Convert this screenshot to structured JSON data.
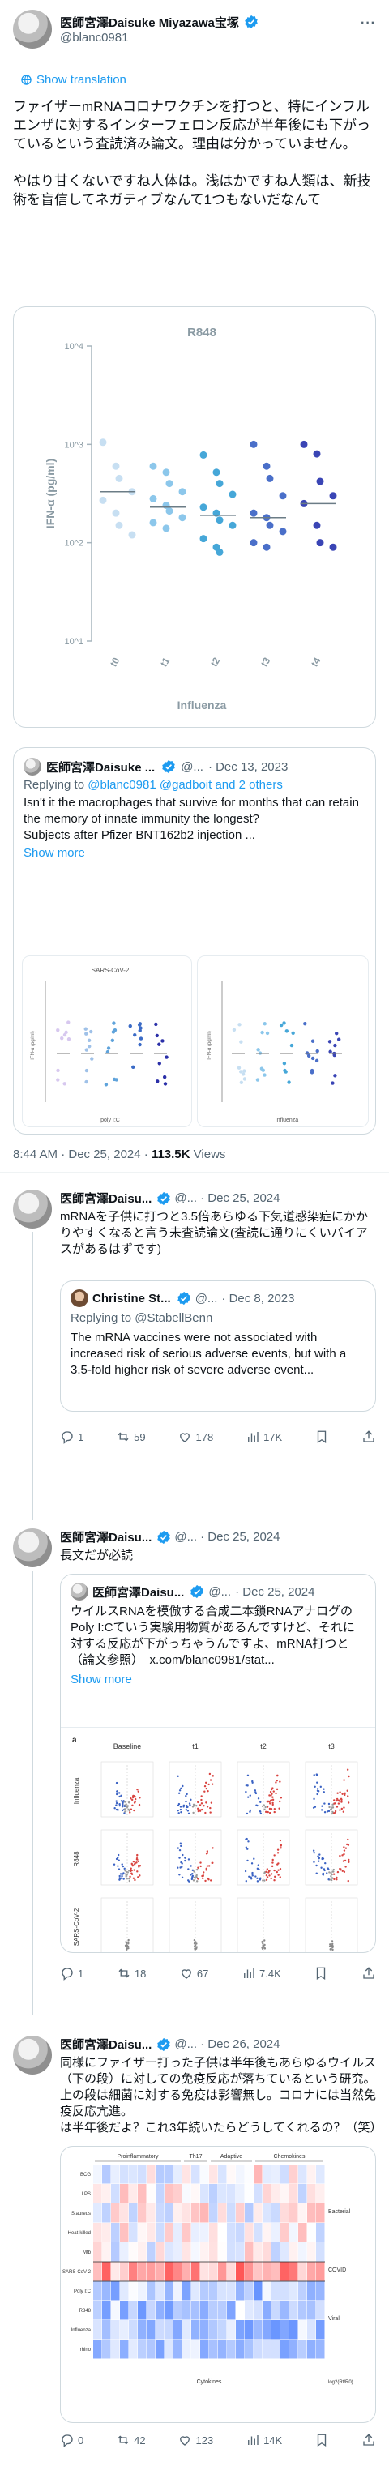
{
  "main_tweet": {
    "author_name": "医師宮澤Daisuke Miyazawa宝塚",
    "handle": "@blanc0981",
    "show_translation": "Show translation",
    "text": "ファイザーmRNAコロナワクチンを打つと、特にインフルエンザに対するインターフェロン反応が半年後にも下がっているという査読済み論文。理由は分かっていません。\n\nやはり甘くないですね人体は。浅はかですね人類は、新技術を盲信してネガティブなんて1つもないだなんて",
    "chart_data": {
      "type": "scatter",
      "title": "R848",
      "ylabel": "IFN-α (pg/ml)",
      "xlabel": "Influenza",
      "categories": [
        "t0",
        "t1",
        "t2",
        "t3",
        "t4"
      ],
      "y_ticks": [
        "10^1",
        "10^2",
        "10^3",
        "10^4"
      ],
      "ylim": [
        10,
        10000
      ],
      "log_scale": true,
      "colors": [
        "#c7dff2",
        "#8cc7eb",
        "#46a7d8",
        "#4a6fc9",
        "#3a45b5"
      ],
      "medians": [
        330,
        230,
        190,
        180,
        250
      ],
      "series": [
        {
          "values": [
            1050,
            600,
            450,
            330,
            270,
            200,
            150,
            120
          ]
        },
        {
          "values": [
            600,
            520,
            400,
            330,
            280,
            240,
            210,
            180,
            160,
            140
          ]
        },
        {
          "values": [
            780,
            520,
            400,
            310,
            230,
            200,
            170,
            150,
            110,
            90,
            80
          ]
        },
        {
          "values": [
            1000,
            600,
            450,
            300,
            200,
            180,
            150,
            130,
            100,
            90
          ]
        },
        {
          "values": [
            1000,
            800,
            420,
            300,
            250,
            150,
            100,
            90
          ]
        }
      ]
    },
    "quote": {
      "author_name": "医師宮澤Daisuke ...",
      "handle": "@...",
      "date": "· Dec 13, 2023",
      "replying_to": "Replying to",
      "replying_handle": "@blanc0981",
      "replying_rest": "@gadboit and 2 others",
      "text": "Isn't it the macrophages that survive for months that can retain the memory of innate immunity the longest?\nSubjects after Pfizer BNT162b2 injection ...",
      "show_more": "Show more",
      "left_chart_title": "SARS-CoV-2",
      "left_chart_xlabel": "poly I:C",
      "right_chart_xlabel": "Influenza",
      "left_ylabel": "IFN-α (pg/ml)",
      "right_ylabel": "IFN-α (pg/ml)"
    },
    "timestamp": "8:44 AM · Dec 25, 2024 ·",
    "views_count": "113.5K",
    "views_label": "Views"
  },
  "replies": [
    {
      "author_name": "医師宮澤Daisu...",
      "handle": "@...",
      "date": "· Dec 25, 2024",
      "text": "mRNAを子供に打つと3.5倍あらゆる下気道感染症にかかりやすくなると言う未査読論文(査読に通りにくいバイアスがあるはずです)",
      "quote": {
        "author_name": "Christine St...",
        "handle": "@...",
        "date": "· Dec 8, 2023",
        "replying": "Replying to @StabellBenn",
        "text": "The mRNA vaccines were not associated with increased risk of serious adverse events, but with a 3.5-fold higher risk of severe adverse event..."
      },
      "stats": {
        "replies": "1",
        "reposts": "59",
        "likes": "178",
        "views": "17K"
      }
    },
    {
      "author_name": "医師宮澤Daisu...",
      "handle": "@...",
      "date": "· Dec 25, 2024",
      "text": "長文だが必読",
      "quote": {
        "author_name": "医師宮澤Daisu...",
        "handle": "@...",
        "date": "· Dec 25, 2024",
        "text": "ウイルスRNAを模倣する合成二本鎖RNAアナログのPoly I:Cていう実験用物質があるんですけど、それに対する反応が下がっちゃうんですよ、mRNA打つと（論文参照）　x.com/blanc0981/stat...",
        "show_more": "Show more",
        "col_labels": [
          "Baseline",
          "t1",
          "t2",
          "t3"
        ],
        "row_labels": [
          "Influenza",
          "R848",
          "SARS-CoV-2"
        ],
        "panel_letter": "a"
      },
      "stats": {
        "replies": "1",
        "reposts": "18",
        "likes": "67",
        "views": "7.4K"
      }
    },
    {
      "author_name": "医師宮澤Daisu...",
      "handle": "@...",
      "date": "· Dec 26, 2024",
      "text": "同様にファイザー打った子供は半年後もあらゆるウイルス（下の段）に対しての免疫反応が落ちているという研究。\n上の段は細菌に対する免疫は影響無し。コロナには当然免疫反応亢進。\nは半年後だよ？これ3年続いたらどうしてくれるの？（笑）",
      "heatmap": {
        "group_labels": [
          "Proinflammatory",
          "Th17",
          "Adaptive",
          "Chemokines"
        ],
        "side_labels": [
          "Bacterial",
          "COVID",
          "Viral"
        ],
        "row_labels": [
          "BCG",
          "LPS",
          "S.aureus",
          "Heat-killed",
          "Mtb",
          "SARS-CoV-2",
          "Poly I:C",
          "R848",
          "Influenza",
          "rhino"
        ],
        "xlabel": "Cytokines",
        "legend_label": "log2(Rt/R0)"
      },
      "stats": {
        "replies": "0",
        "reposts": "42",
        "likes": "123",
        "views": "14K"
      }
    }
  ],
  "icons": [
    "verified-badge-icon",
    "globe-icon",
    "more-icon",
    "reply-icon",
    "repost-icon",
    "like-icon",
    "views-icon",
    "bookmark-icon",
    "share-icon"
  ],
  "colors": {
    "link": "#1d9bf0",
    "verified": "#1d9bf0",
    "text": "#0f1419",
    "dim": "#536471",
    "border": "#cfd9de"
  }
}
